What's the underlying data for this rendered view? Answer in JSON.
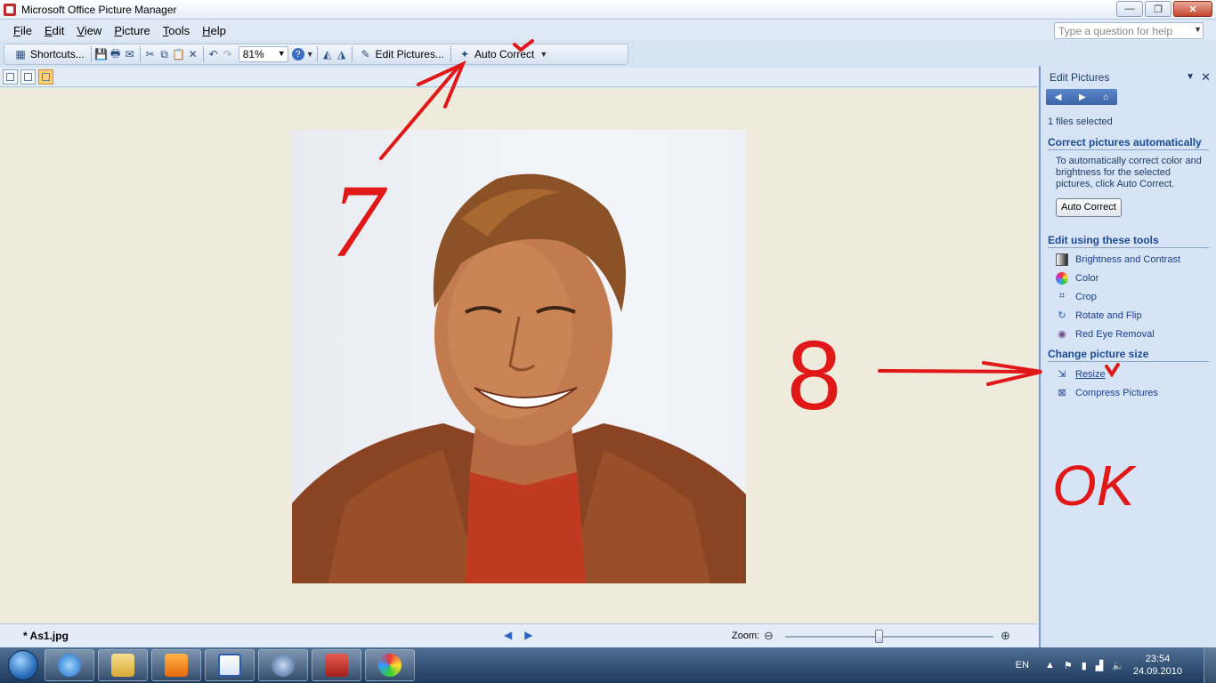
{
  "window": {
    "title": "Microsoft Office Picture Manager",
    "minimize": "—",
    "maximize": "❐",
    "close": "✕"
  },
  "menu": {
    "items": [
      {
        "label_u": "F",
        "label_rest": "ile"
      },
      {
        "label_u": "E",
        "label_rest": "dit"
      },
      {
        "label_u": "V",
        "label_rest": "iew"
      },
      {
        "label_u": "P",
        "label_rest": "icture"
      },
      {
        "label_u": "T",
        "label_rest": "ools"
      },
      {
        "label_u": "H",
        "label_rest": "elp"
      }
    ],
    "help_placeholder": "Type a question for help"
  },
  "toolbar": {
    "shortcuts": "Shortcuts...",
    "zoom_value": "81%",
    "edit_pictures": "Edit Pictures...",
    "auto_correct": "Auto Correct"
  },
  "status": {
    "file_name": "* As1.jpg",
    "zoom_label": "Zoom:",
    "zoom_level": 0.45
  },
  "pane": {
    "title": "Edit Pictures",
    "files_selected": "1 files selected",
    "section_auto": "Correct pictures automatically",
    "auto_desc": "To automatically correct color and brightness for the selected pictures, click Auto Correct.",
    "auto_button": "Auto Correct",
    "section_tools": "Edit using these tools",
    "tools": [
      {
        "label": "Brightness and Contrast",
        "icon": "brightness-icon"
      },
      {
        "label": "Color",
        "icon": "color-icon"
      },
      {
        "label": "Crop",
        "icon": "crop-icon"
      },
      {
        "label": "Rotate and Flip",
        "icon": "rotate-icon"
      },
      {
        "label": "Red Eye Removal",
        "icon": "eye-icon"
      }
    ],
    "section_size": "Change picture size",
    "size_tools": [
      {
        "label": "Resize",
        "icon": "resize-icon"
      },
      {
        "label": "Compress Pictures",
        "icon": "compress-icon"
      }
    ]
  },
  "annotations": {
    "step7": "7",
    "step8": "8",
    "ok": "OK"
  },
  "taskbar": {
    "lang": "EN",
    "time": "23:54",
    "date": "24.09.2010"
  }
}
